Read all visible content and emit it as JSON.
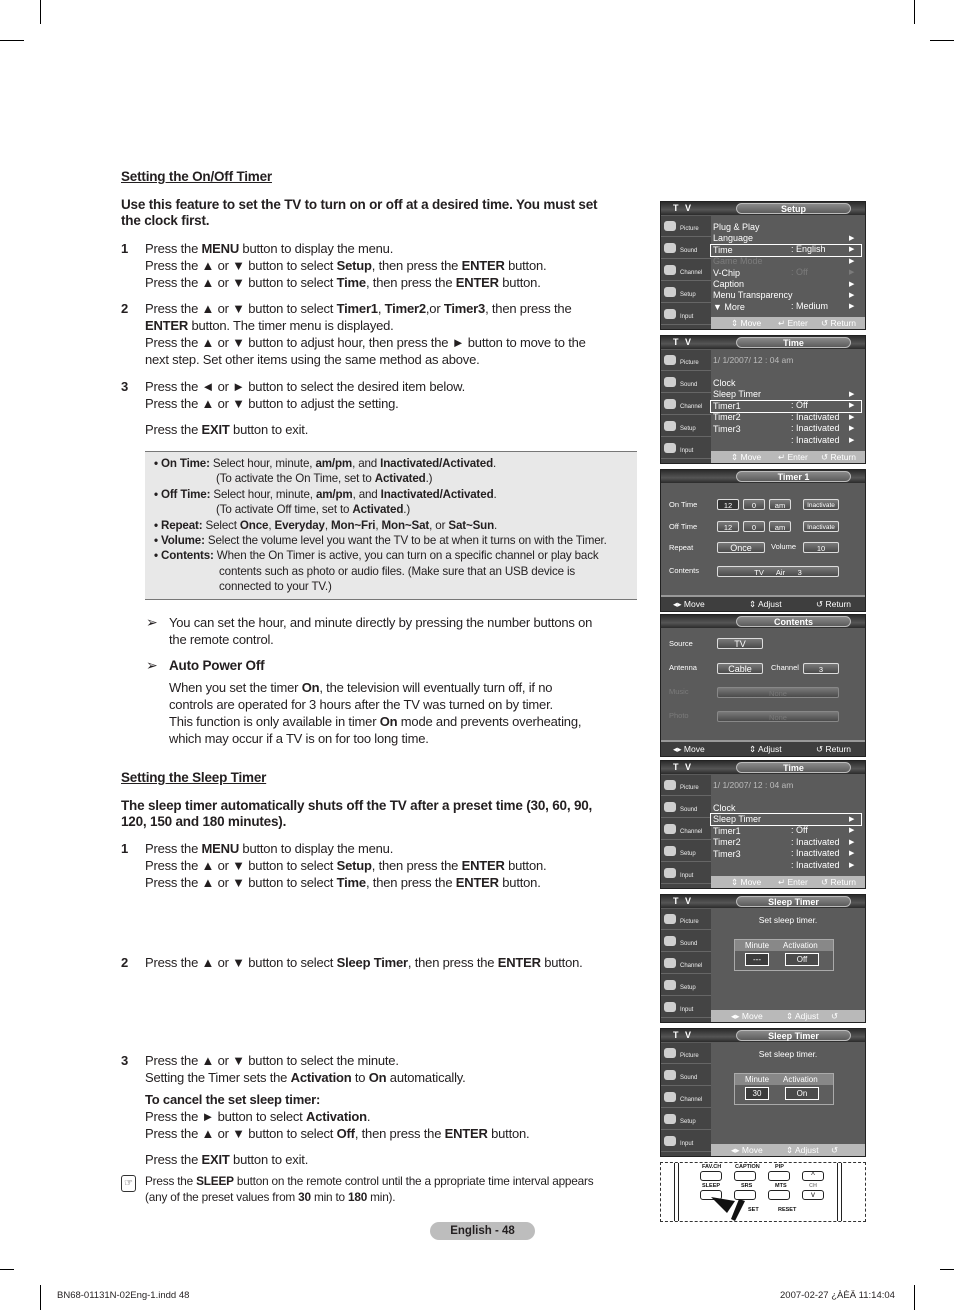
{
  "on_off": {
    "heading": "Setting the On/Off Timer",
    "intro": [
      [
        "",
        "Use this feature to set the TV to turn on or off at a desired time. You must set"
      ],
      [
        "",
        "the clock first."
      ]
    ],
    "step1": {
      "num": "1",
      "lines": [
        [
          "Press the ",
          "MENU",
          " button to display the menu."
        ],
        [
          "Press the ▲ or ▼ button to select ",
          "Setup",
          ", then press the ",
          "ENTER",
          " button."
        ],
        [
          "Press the ▲ or ▼ button to select ",
          "Time",
          ", then press the ",
          "ENTER",
          " button."
        ]
      ]
    },
    "step2": {
      "num": "2",
      "lines": [
        [
          "Press the ▲ or ▼ button to select ",
          "Timer1",
          ", ",
          "Timer2",
          ",or ",
          "Timer3",
          ", then press the"
        ],
        [
          "",
          "ENTER",
          " button. The timer menu is displayed."
        ],
        [
          "Press the ▲ or ▼ button to adjust hour, then press the ► button to move to the"
        ],
        [
          "next step. Set other items using the same method as above."
        ]
      ]
    },
    "step3": {
      "num": "3",
      "lines": [
        [
          "Press the ◄ or ► button to select the desired item below."
        ],
        [
          "Press the ▲ or ▼ button to adjust the setting."
        ]
      ],
      "exit": [
        "Press the ",
        "EXIT",
        " button to exit."
      ]
    },
    "notes": [
      [
        "",
        "• On Time:",
        " Select hour, minute, ",
        "am/pm",
        ", and ",
        "Inactivated/Activated",
        "."
      ],
      [
        "(To activate the On Time, set to ",
        "Activated",
        ".)"
      ],
      [
        "",
        "• Off Time:",
        " Select hour, minute, ",
        "am/pm",
        ", and ",
        "Inactivated/Activated",
        "."
      ],
      [
        "(To activate Off time, set to ",
        "Activated",
        ".)"
      ],
      [
        "",
        "• Repeat:",
        " Select ",
        "Once",
        ", ",
        "Everyday",
        ", ",
        "Mon~Fri",
        ", ",
        "Mon~Sat",
        ", or ",
        "Sat~Sun",
        "."
      ],
      [
        "",
        "• Volume:",
        " Select the volume level you want the TV to be at when it turns on with the Timer."
      ],
      [
        "",
        "• Contents:",
        " When the On Timer is active, you can turn on a specific channel or play back"
      ],
      [
        "contents such as photo or audio files. (Make sure that an USB device is"
      ],
      [
        "connected to your TV.)"
      ]
    ],
    "tip_marker": "➢",
    "tip": [
      [
        "You can set the hour, and minute directly by pressing the number buttons on"
      ],
      [
        "the remote control."
      ]
    ],
    "auto_power_off": {
      "title": "Auto Power Off",
      "lines": [
        [
          "When you set the timer ",
          "On",
          ", the television will eventually turn off, if no"
        ],
        [
          "controls are operated for 3 hours after the TV was turned on by timer."
        ],
        [
          "This function is only available in timer ",
          "On",
          " mode and prevents overheating,"
        ],
        [
          "which may occur if a TV is on for too long time."
        ]
      ]
    }
  },
  "sleep": {
    "heading": "Setting the Sleep Timer",
    "intro": [
      [
        "",
        "The sleep timer automatically shuts off the TV after a preset time (30, 60, 90,"
      ],
      [
        "",
        "120, 150 and 180 minutes)."
      ]
    ],
    "step1": {
      "num": "1",
      "lines": [
        [
          "Press the ",
          "MENU",
          " button to display the menu."
        ],
        [
          "Press the ▲ or ▼ button to select ",
          "Setup",
          ", then press the ",
          "ENTER",
          " button."
        ],
        [
          "Press the ▲ or ▼ button to select ",
          "Time",
          ", then press the ",
          "ENTER",
          " button."
        ]
      ]
    },
    "step2": {
      "num": "2",
      "lines": [
        [
          "Press the ▲ or ▼ button to select ",
          "Sleep Timer",
          ", then press the ",
          "ENTER",
          " button."
        ]
      ]
    },
    "step3": {
      "num": "3",
      "lines": [
        [
          "Press the ▲ or ▼ button to select the minute."
        ],
        [
          "Setting the Timer sets the ",
          "Activation",
          " to ",
          "On",
          " automatically."
        ]
      ]
    },
    "cancel_title": "To cancel the set sleep timer:",
    "cancel_lines": [
      [
        "Press the ► button to select ",
        "Activation",
        "."
      ],
      [
        "Press the ▲ or ▼ button to select ",
        "Off",
        ", then press the ",
        "ENTER",
        " button."
      ]
    ],
    "exit": [
      "Press the ",
      "EXIT",
      " button to exit."
    ],
    "note": [
      [
        "Press the ",
        "SLEEP",
        " button on the remote control until the a ppropriate time interval appears"
      ],
      [
        "(any of the preset values from ",
        "30",
        " min to ",
        "180",
        " min)."
      ]
    ]
  },
  "tv_sidebar": [
    "Picture",
    "Sound",
    "Channel",
    "Setup",
    "Input"
  ],
  "screens": [
    {
      "kind": "menu",
      "left": "T V",
      "title": "Setup",
      "rows": [
        {
          "label": "Plug & Play",
          "value": "",
          "arrow": "▶"
        },
        {
          "label": "Language",
          "value": ": English",
          "arrow": "▶"
        },
        {
          "label": "Time",
          "value": "",
          "arrow": "▶",
          "selected": true
        },
        {
          "label": "Game Mode",
          "value": ": Off",
          "arrow": "▶",
          "dim": true
        },
        {
          "label": "V-Chip",
          "value": "",
          "arrow": "▶"
        },
        {
          "label": "Caption",
          "value": "",
          "arrow": "▶"
        },
        {
          "label": "Menu Transparency",
          "value": ": Medium",
          "arrow": "▶"
        },
        {
          "label": "▼ More",
          "value": "",
          "arrow": ""
        }
      ],
      "footer": [
        "⇕ Move",
        "↵ Enter",
        "↺ Return"
      ]
    },
    {
      "kind": "menu",
      "left": "T V",
      "title": "Time",
      "date": "1/  1/2007/ 12 : 04  am",
      "rows": [
        {
          "label": "Clock",
          "value": "",
          "arrow": "▶"
        },
        {
          "label": "Sleep Timer",
          "value": ": Off",
          "arrow": "▶"
        },
        {
          "label": "Timer1",
          "value": ": Inactivated",
          "arrow": "▶",
          "selected": true
        },
        {
          "label": "Timer2",
          "value": ": Inactivated",
          "arrow": "▶"
        },
        {
          "label": "Timer3",
          "value": ": Inactivated",
          "arrow": "▶"
        }
      ],
      "footer": [
        "⇕ Move",
        "↵ Enter",
        "↺ Return"
      ]
    },
    {
      "kind": "timer",
      "title": "Timer 1",
      "fields": [
        {
          "label": "On Time",
          "hour": "12",
          "minute": "0",
          "ampm": "am",
          "state": "Inactivate"
        },
        {
          "label": "Off Time",
          "hour": "12",
          "minute": "0",
          "ampm": "am",
          "state": "Inactivate"
        }
      ],
      "repeat_label": "Repeat",
      "repeat": "Once",
      "volume_label": "Volume",
      "volume": "10",
      "contents_label": "Contents",
      "contents": "TV      Air      3",
      "footer": [
        "◂▸ Move",
        "⇕ Adjust",
        "↺ Return"
      ]
    },
    {
      "kind": "contents",
      "title": "Contents",
      "source_label": "Source",
      "source": "TV",
      "antenna_label": "Antenna",
      "antenna": "Cable",
      "channel_label": "Channel",
      "channel": "3",
      "music_label": "Music",
      "music": "None",
      "photo_label": "Photo",
      "photo": "None",
      "footer": [
        "◂▸ Move",
        "⇕ Adjust",
        "↺ Return"
      ]
    },
    {
      "kind": "menu",
      "left": "T V",
      "title": "Time",
      "date": "1/  1/2007/ 12 : 04  am",
      "rows": [
        {
          "label": "Clock",
          "value": "",
          "arrow": "▶"
        },
        {
          "label": "Sleep Timer",
          "value": ": Off",
          "arrow": "▶",
          "selected": true
        },
        {
          "label": "Timer1",
          "value": ": Inactivated",
          "arrow": "▶"
        },
        {
          "label": "Timer2",
          "value": ": Inactivated",
          "arrow": "▶"
        },
        {
          "label": "Timer3",
          "value": ": Inactivated",
          "arrow": "▶"
        }
      ],
      "footer": [
        "⇕ Move",
        "↵ Enter",
        "↺ Return"
      ]
    },
    {
      "kind": "sleep",
      "left": "T V",
      "title": "Sleep Timer",
      "prompt": "Set sleep timer.",
      "minute_label": "Minute",
      "activation_label": "Activation",
      "minute": "---",
      "activation": "Off",
      "footer": [
        "◂▸ Move",
        "⇕ Adjust",
        "↺ Return"
      ]
    },
    {
      "kind": "sleep",
      "left": "T V",
      "title": "Sleep Timer",
      "prompt": "Set sleep timer.",
      "minute_label": "Minute",
      "activation_label": "Activation",
      "minute": "30",
      "activation": "On",
      "footer": [
        "◂▸ Move",
        "⇕ Adjust",
        "↺ Return"
      ]
    }
  ],
  "remote": {
    "buttons_top": [
      "FAV.CH",
      "CAPTION",
      "PIP",
      "CH"
    ],
    "buttons_bottom": [
      "SLEEP",
      "SRS",
      "MTS"
    ],
    "set_label": "SET",
    "reset_label": "RESET"
  },
  "page_label": "English - 48",
  "footer": {
    "file": "BN68-01131N-02Eng-1.indd   48",
    "timestamp": "2007-02-27   ¿ÀÈÄ 11:14:04"
  }
}
